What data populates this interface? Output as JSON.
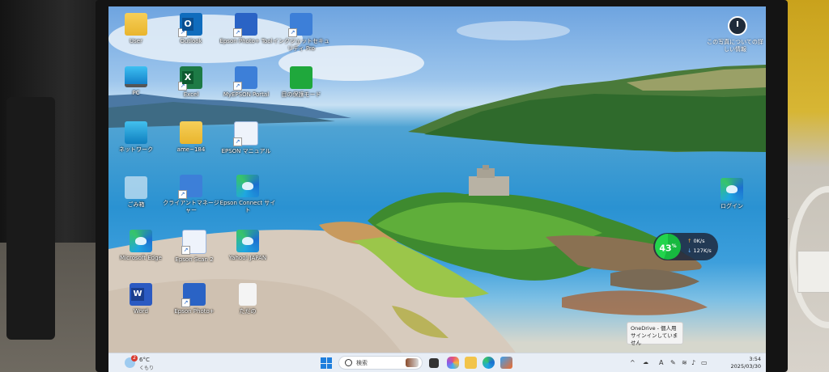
{
  "desktop_icons": [
    {
      "id": "user",
      "label": "User",
      "icon": "folder-icon"
    },
    {
      "id": "outlook",
      "label": "Outlook",
      "icon": "outlook-icon"
    },
    {
      "id": "epson-photo-tool",
      "label": "Epson Photo+ Tool",
      "icon": "epson-photo-tool-icon"
    },
    {
      "id": "insight-security",
      "label": "インクジェットセキュリティ Pro",
      "icon": "security-icon"
    },
    {
      "id": "pc",
      "label": "PC",
      "icon": "monitor-icon"
    },
    {
      "id": "excel",
      "label": "Excel",
      "icon": "excel-icon"
    },
    {
      "id": "myepson-portal",
      "label": "MyEPSON Portal",
      "icon": "info-icon"
    },
    {
      "id": "eye-mode",
      "label": "目の保護モード",
      "icon": "eye-icon"
    },
    {
      "id": "network",
      "label": "ネットワーク",
      "icon": "network-icon"
    },
    {
      "id": "ame-184",
      "label": "ame~184",
      "icon": "folder-icon"
    },
    {
      "id": "epson-manual",
      "label": "EPSON マニュアル",
      "icon": "manual-icon"
    },
    {
      "id": "recycle-bin",
      "label": "ごみ箱",
      "icon": "recycle-bin-icon"
    },
    {
      "id": "cloud-manager",
      "label": "クライアントマネージャー",
      "icon": "wireless-icon"
    },
    {
      "id": "epson-connect",
      "label": "Epson Connect サイト",
      "icon": "edge-icon"
    },
    {
      "id": "microsoft-edge",
      "label": "Microsoft Edge",
      "icon": "edge-icon"
    },
    {
      "id": "epson-scan-2",
      "label": "Epson Scan 2",
      "icon": "scanner-icon"
    },
    {
      "id": "yahoo-japan",
      "label": "Yahoo! JAPAN",
      "icon": "edge-icon"
    },
    {
      "id": "word",
      "label": "Word",
      "icon": "word-icon"
    },
    {
      "id": "epson-photo-plus",
      "label": "Epson Photo+",
      "icon": "photo-plus-icon"
    },
    {
      "id": "text-file",
      "label": "ただの",
      "icon": "document-icon"
    },
    {
      "id": "login",
      "label": "ログイン",
      "icon": "edge-icon"
    }
  ],
  "top_right": {
    "label": "この写真についての詳しい情報",
    "icon": "spotlight-icon"
  },
  "net_monitor": {
    "percent": "43",
    "unit": "%",
    "up": "0K/s",
    "down": "127K/s"
  },
  "onedrive_tooltip": {
    "line1": "OneDrive - 個人用",
    "line2": "サインインしていません"
  },
  "taskbar": {
    "weather": {
      "temp": "6°C",
      "condition": "くもり",
      "badge": "2"
    },
    "search_placeholder": "検索",
    "time": "3:54",
    "date": "2025/03/30",
    "ime": "A"
  }
}
